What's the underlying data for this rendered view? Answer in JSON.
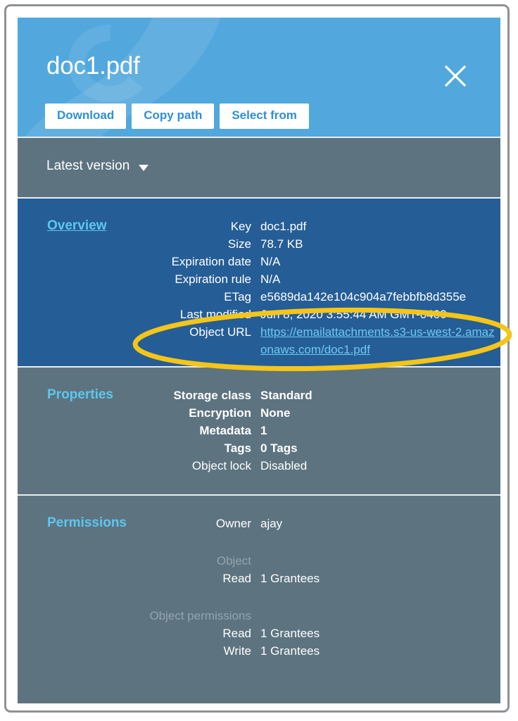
{
  "header": {
    "title": "doc1.pdf",
    "close_icon": "close-icon",
    "buttons": [
      {
        "label": "Download",
        "name": "download-button"
      },
      {
        "label": "Copy path",
        "name": "copy-path-button"
      },
      {
        "label": "Select from",
        "name": "select-from-button"
      }
    ]
  },
  "version_bar": {
    "label": "Latest version",
    "caret_icon": "chevron-down-icon"
  },
  "overview": {
    "heading": "Overview",
    "rows": [
      {
        "key": "Key",
        "value": "doc1.pdf"
      },
      {
        "key": "Size",
        "value": "78.7 KB"
      },
      {
        "key": "Expiration date",
        "value": "N/A"
      },
      {
        "key": "Expiration rule",
        "value": "N/A"
      },
      {
        "key": "ETag",
        "value": "e5689da142e104c904a7febbfb8d355e"
      },
      {
        "key": "Last modified",
        "value": "Jun 8, 2020 3:55:44 AM GMT-0400"
      }
    ],
    "object_url_key": "Object URL",
    "object_url_value": "https://emailattachments.s3-us-west-2.amazonaws.com/doc1.pdf"
  },
  "properties": {
    "heading": "Properties",
    "rows": [
      {
        "key": "Storage class",
        "value": "Standard",
        "bold": true
      },
      {
        "key": "Encryption",
        "value": "None",
        "bold": true
      },
      {
        "key": "Metadata",
        "value": "1",
        "bold": true
      },
      {
        "key": "Tags",
        "value": "0 Tags",
        "bold": true
      },
      {
        "key": "Object lock",
        "value": "Disabled",
        "bold": false
      }
    ]
  },
  "permissions": {
    "heading": "Permissions",
    "owner_key": "Owner",
    "owner_value": "ajay",
    "group1_label": "Object",
    "group1_rows": [
      {
        "key": "Read",
        "value": "1 Grantees"
      }
    ],
    "group2_label": "Object permissions",
    "group2_rows": [
      {
        "key": "Read",
        "value": "1 Grantees"
      },
      {
        "key": "Write",
        "value": "1 Grantees"
      }
    ]
  },
  "annotation": {
    "shape": "ellipse-highlight",
    "color": "#f5c518",
    "target": "Object URL"
  },
  "colors": {
    "header_blue": "#52a8dd",
    "overview_blue": "#255d96",
    "slate": "#5d7380",
    "accent_cyan": "#5bc8ee",
    "link_cyan": "#6ec9ef",
    "button_text": "#2d8fd5",
    "annotation_yellow": "#f5c518"
  }
}
